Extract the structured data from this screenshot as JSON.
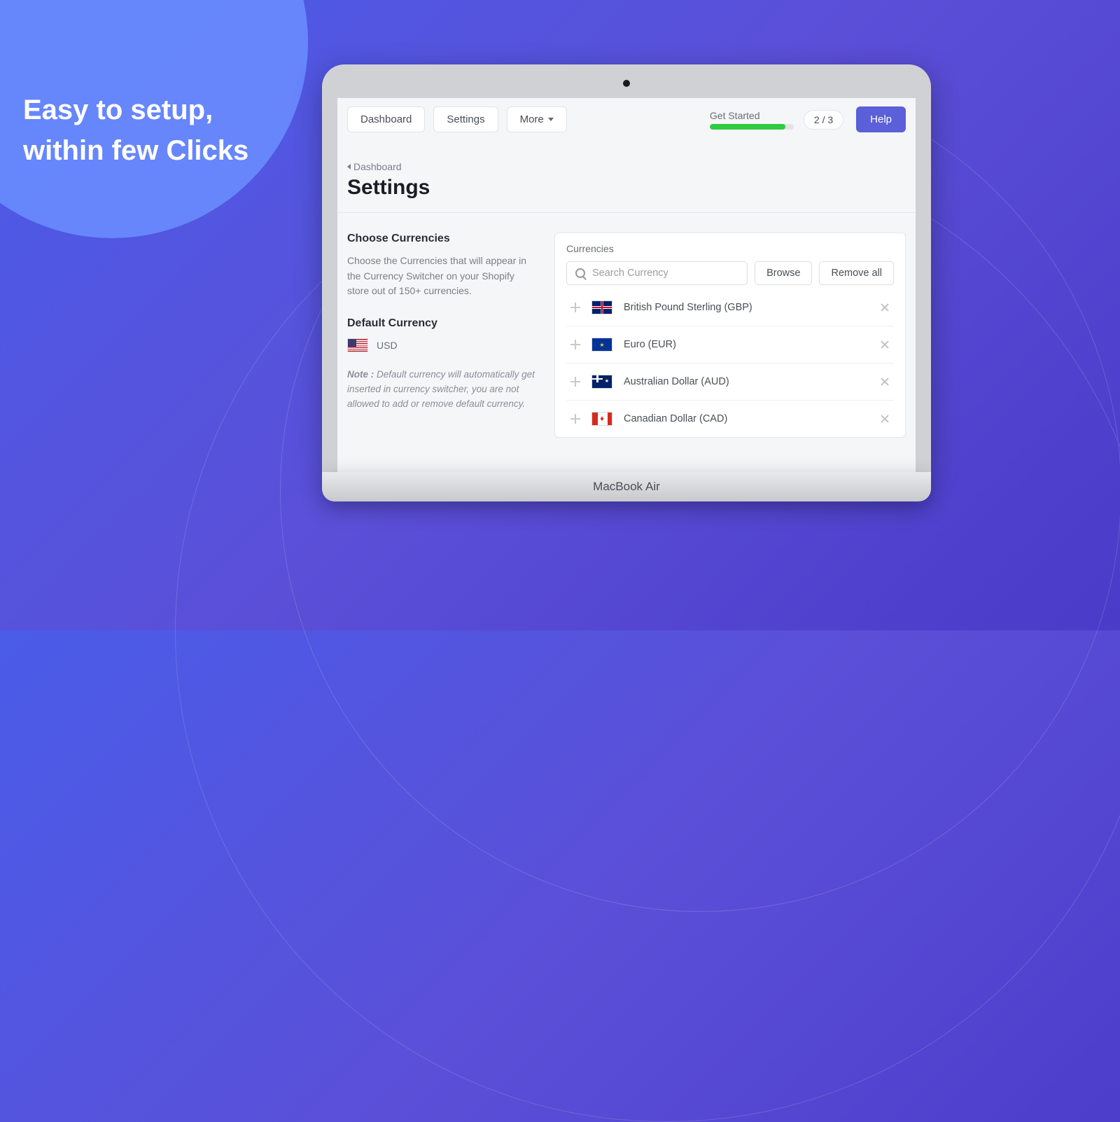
{
  "hero": {
    "line1": "Easy to setup,",
    "line2": "within few Clicks"
  },
  "nav": {
    "dashboard": "Dashboard",
    "settings": "Settings",
    "more": "More"
  },
  "getStarted": {
    "label": "Get Started",
    "counter": "2 / 3"
  },
  "help": "Help",
  "breadcrumb": "Dashboard",
  "pageTitle": "Settings",
  "choose": {
    "title": "Choose Currencies",
    "desc": "Choose the Currencies that will appear in the Currency Switcher on your Shopify store out of 150+ currencies."
  },
  "default": {
    "title": "Default Currency",
    "code": "USD"
  },
  "note": {
    "label": "Note :",
    "text": " Default currency will automatically get inserted in currency switcher, you are not allowed to add or remove default currency."
  },
  "currenciesCard": {
    "label": "Currencies",
    "searchPlaceholder": "Search Currency",
    "browse": "Browse",
    "removeAll": "Remove all"
  },
  "currencies": [
    {
      "name": "British Pound Sterling (GBP)",
      "flag": "gb"
    },
    {
      "name": "Euro (EUR)",
      "flag": "eu"
    },
    {
      "name": "Australian Dollar (AUD)",
      "flag": "au"
    },
    {
      "name": "Canadian Dollar (CAD)",
      "flag": "ca"
    }
  ],
  "laptopBrand": {
    "a": "MacBook",
    "b": "Air"
  }
}
